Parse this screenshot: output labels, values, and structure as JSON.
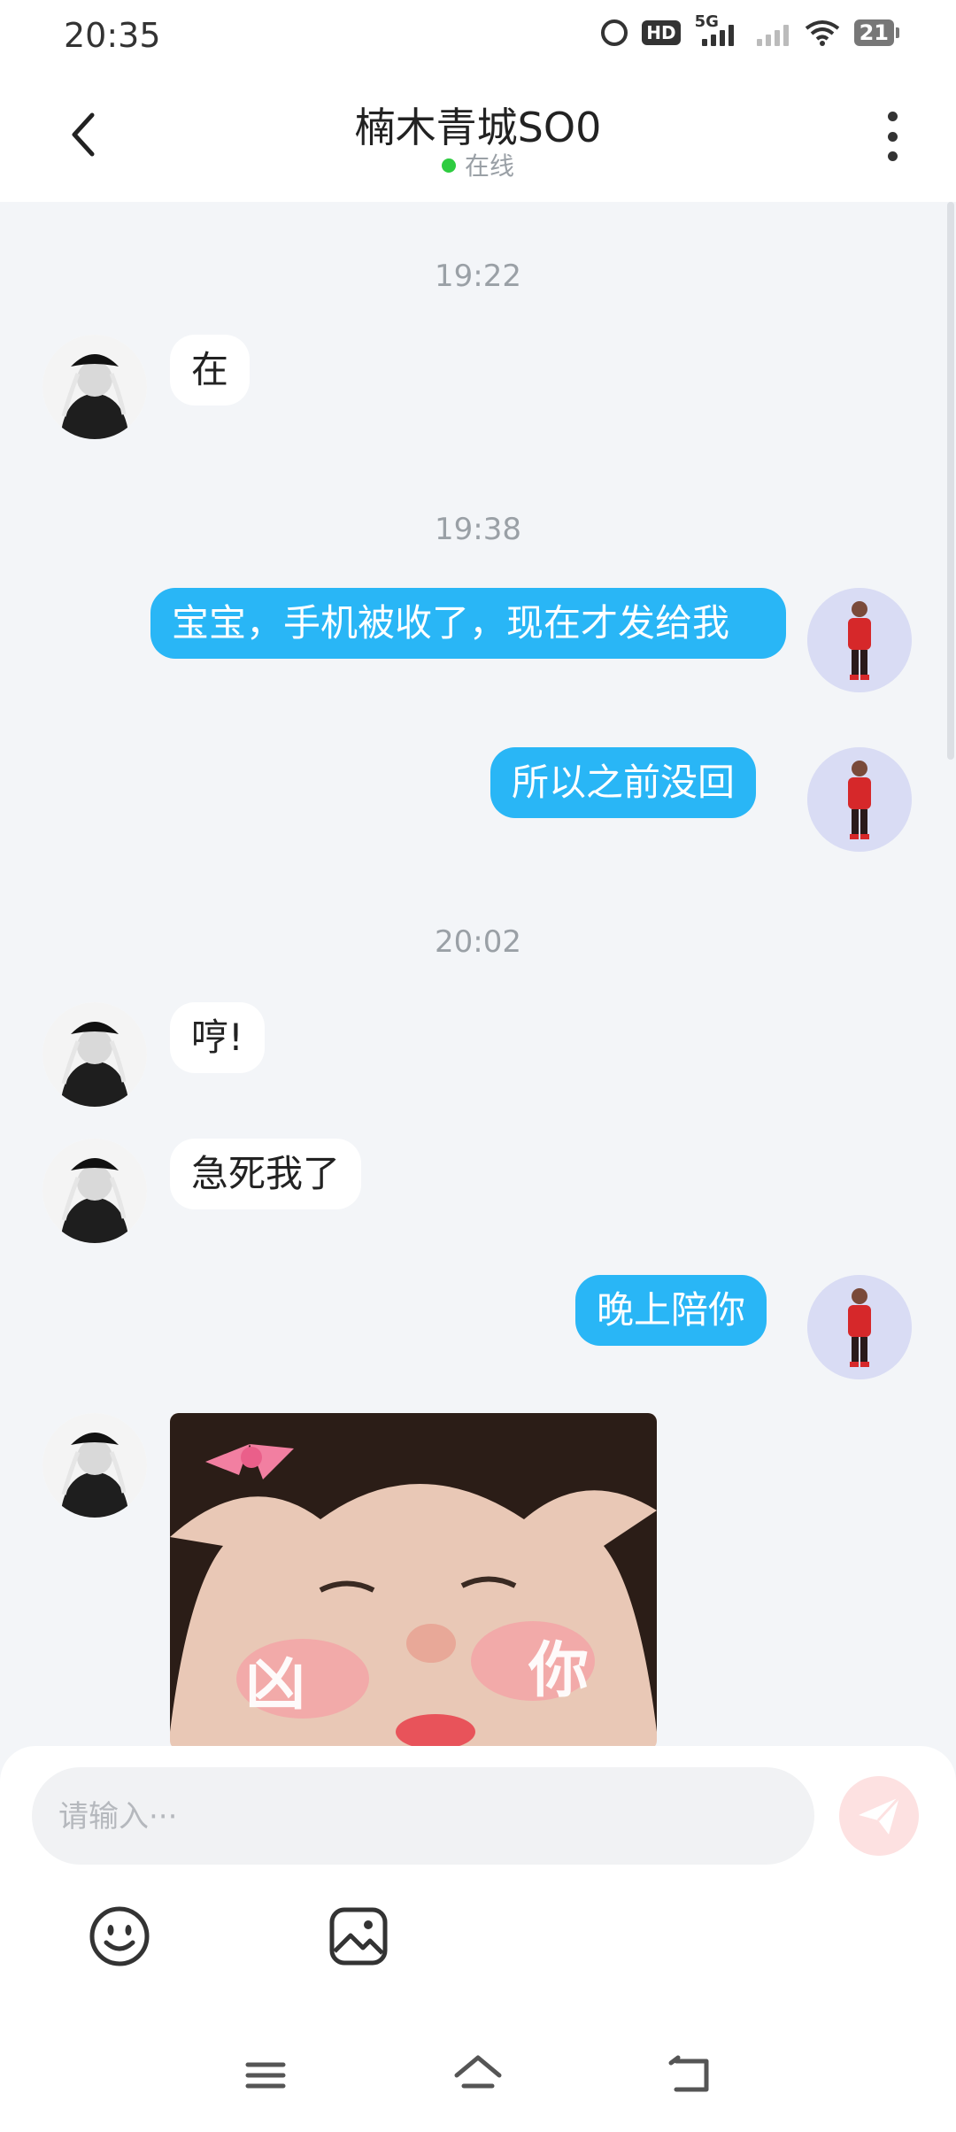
{
  "status_bar": {
    "time": "20:35",
    "hd_label": "HD",
    "network_label": "5G",
    "battery_level": "21",
    "icons": [
      "alarm-icon",
      "hd-icon",
      "5g-signal-icon",
      "signal-icon",
      "wifi-icon",
      "battery-icon"
    ]
  },
  "header": {
    "title": "楠木青城SO0",
    "status": "在线",
    "status_color": "#2ecc40",
    "back_icon": "chevron-left-icon",
    "more_icon": "more-vertical-icon"
  },
  "chat": {
    "timestamps": [
      "19:22",
      "19:38",
      "20:02"
    ],
    "messages": [
      {
        "side": "in",
        "text": "在"
      },
      {
        "side": "out",
        "text": "宝宝，手机被收了，现在才发给我"
      },
      {
        "side": "out",
        "text": "所以之前没回"
      },
      {
        "side": "in",
        "text": "哼!"
      },
      {
        "side": "in",
        "text": "急死我了"
      },
      {
        "side": "out",
        "text": "晚上陪你"
      },
      {
        "side": "in",
        "type": "image",
        "caption_left": "凶",
        "caption_right": "你"
      }
    ],
    "outgoing_bubble_color": "#29b6f6",
    "incoming_bubble_color": "#ffffff"
  },
  "composer": {
    "placeholder": "请输入···",
    "value": "",
    "send_icon": "send-icon",
    "emoji_icon": "emoji-icon",
    "image_icon": "image-icon"
  },
  "nav": {
    "icons": [
      "menu-icon",
      "home-icon",
      "back-icon"
    ]
  }
}
